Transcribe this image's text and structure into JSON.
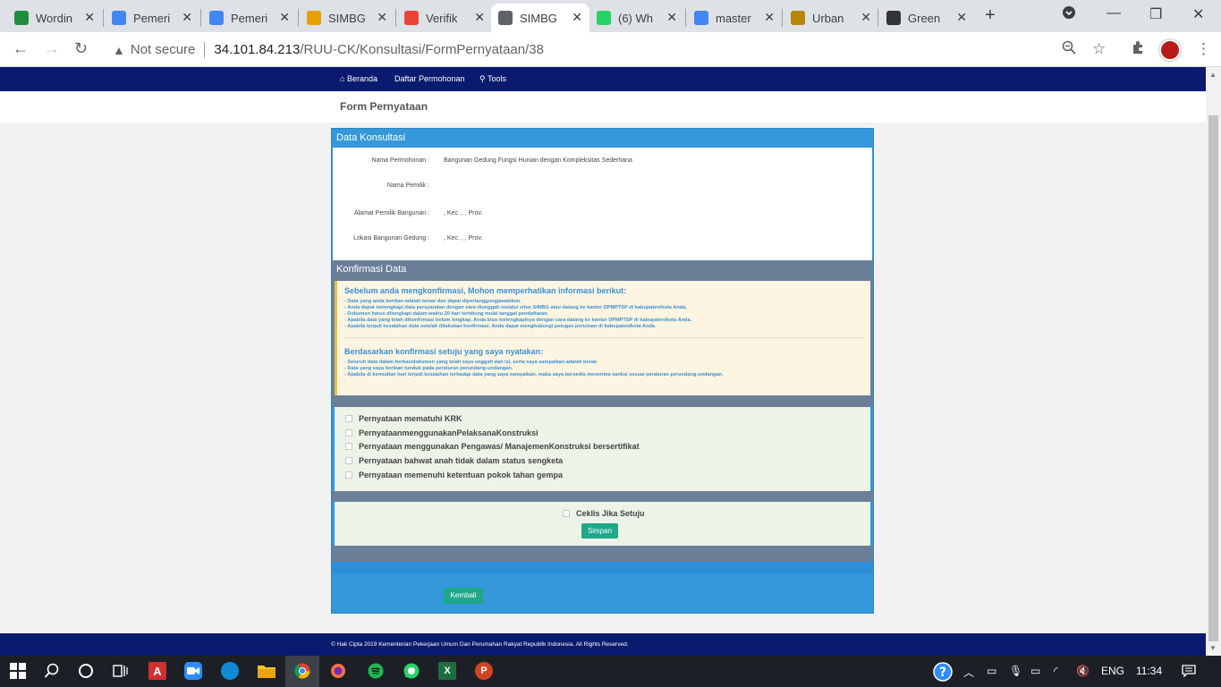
{
  "browser": {
    "tabs": [
      {
        "label": "Wordin",
        "favicon_color": "#1e8e3e"
      },
      {
        "label": "Pemeri",
        "favicon_color": "#4285f4"
      },
      {
        "label": "Pemeri",
        "favicon_color": "#4285f4"
      },
      {
        "label": "SIMBG",
        "favicon_color": "#e6a100"
      },
      {
        "label": "Verifik",
        "favicon_color": "#ea4335"
      },
      {
        "label": "SIMBG",
        "favicon_color": "#5f6368"
      },
      {
        "label": "(6) Wh",
        "favicon_color": "#25d366"
      },
      {
        "label": "master",
        "favicon_color": "#4285f4"
      },
      {
        "label": "Urban",
        "favicon_color": "#b8860b"
      },
      {
        "label": "Green",
        "favicon_color": "#333333"
      }
    ],
    "active_tab_index": 5,
    "security_label": "Not secure",
    "url_host": "34.101.84.213",
    "url_path": "/RUU-CK/Konsultasi/FormPernyataan/38"
  },
  "nav": {
    "items": [
      "Beranda",
      "Daftar Permohonan",
      "Tools"
    ]
  },
  "page_title": "Form Pernyataan",
  "data_konsultasi": {
    "heading": "Data Konsultasi",
    "rows": [
      {
        "label": "Nama Permohonan :",
        "value": "Bangunan Gedung Fungsi Hunian dengan Kompleksitas Sederhana"
      },
      {
        "label": "Nama Pemilik :",
        "value": ""
      },
      {
        "label": "Alamat Pemilik Bangunan :",
        "value": ", Kec. , , Prov."
      },
      {
        "label": "Lokasi Bangunan Gedung :",
        "value": ", Kec. , , Prov."
      }
    ]
  },
  "konfirmasi": {
    "heading": "Konfirmasi Data",
    "info_title": "Sebelum anda mengkonfirmasi, Mohon memperhatikan informasi berikut:",
    "info_items": [
      "- Data yang anda berikan adalah benar dan dapat dipertanggungjawabkan.",
      "- Anda dapat melengkapi data persyaratan dengan cara diunggah melalui situs SIMBG atau datang ke kantor DPMPTSP di kabupaten/kota Anda.",
      "- Dokumen harus dilengkapi dalam waktu 20 hari terhitung mulai tanggal pendaftaran.",
      "- Apabila data yang telah dikonfirmasi belum lengkap, Anda bisa melengkapinya dengan cara datang ke kantor DPMPTSP di kabupaten/kota Anda.",
      "- Apabila terjadi kesalahan data setelah dilakukan konfirmasi, Anda dapat menghubungi petugas perizinan di kabupaten/kota Anda."
    ],
    "agree_title": "Berdasarkan konfirmasi setuju yang saya nyatakan:",
    "agree_items": [
      "- Seluruh data dalam berkas/dokumen yang telah saya unggah dan isi, serta saya sampaikan adalah benar.",
      "- Data yang saya berikan tunduk pada peraturan perundang-undangan.",
      "- Apabila di kemudian hari terjadi kesalahan terhadap data yang saya sampaikan, maka saya bersedia menerima sanksi sesuai peraturan perundang-undangan."
    ]
  },
  "statements": [
    "Pernyataan mematuhi KRK",
    "PernyataanmenggunakanPelaksanaKonstruksi",
    "Pernyataan menggunakan Pengawas/ ManajemenKonstruksi bersertifikat",
    "Pernyataan bahwat anah tidak dalam status sengketa",
    "Pernyataan memenuhi ketentuan pokok tahan gempa"
  ],
  "agree_label": "Ceklis Jika Setuju",
  "save_label": "Simpan",
  "back_label": "Kembali",
  "footer_text": "© Hak Cipta 2019 Kementerian Pekerjaan Umum Dan Perumahan Rakyat Republik Indonesia. All Rights Reserved.",
  "taskbar": {
    "language": "ENG",
    "clock": "11:34"
  }
}
